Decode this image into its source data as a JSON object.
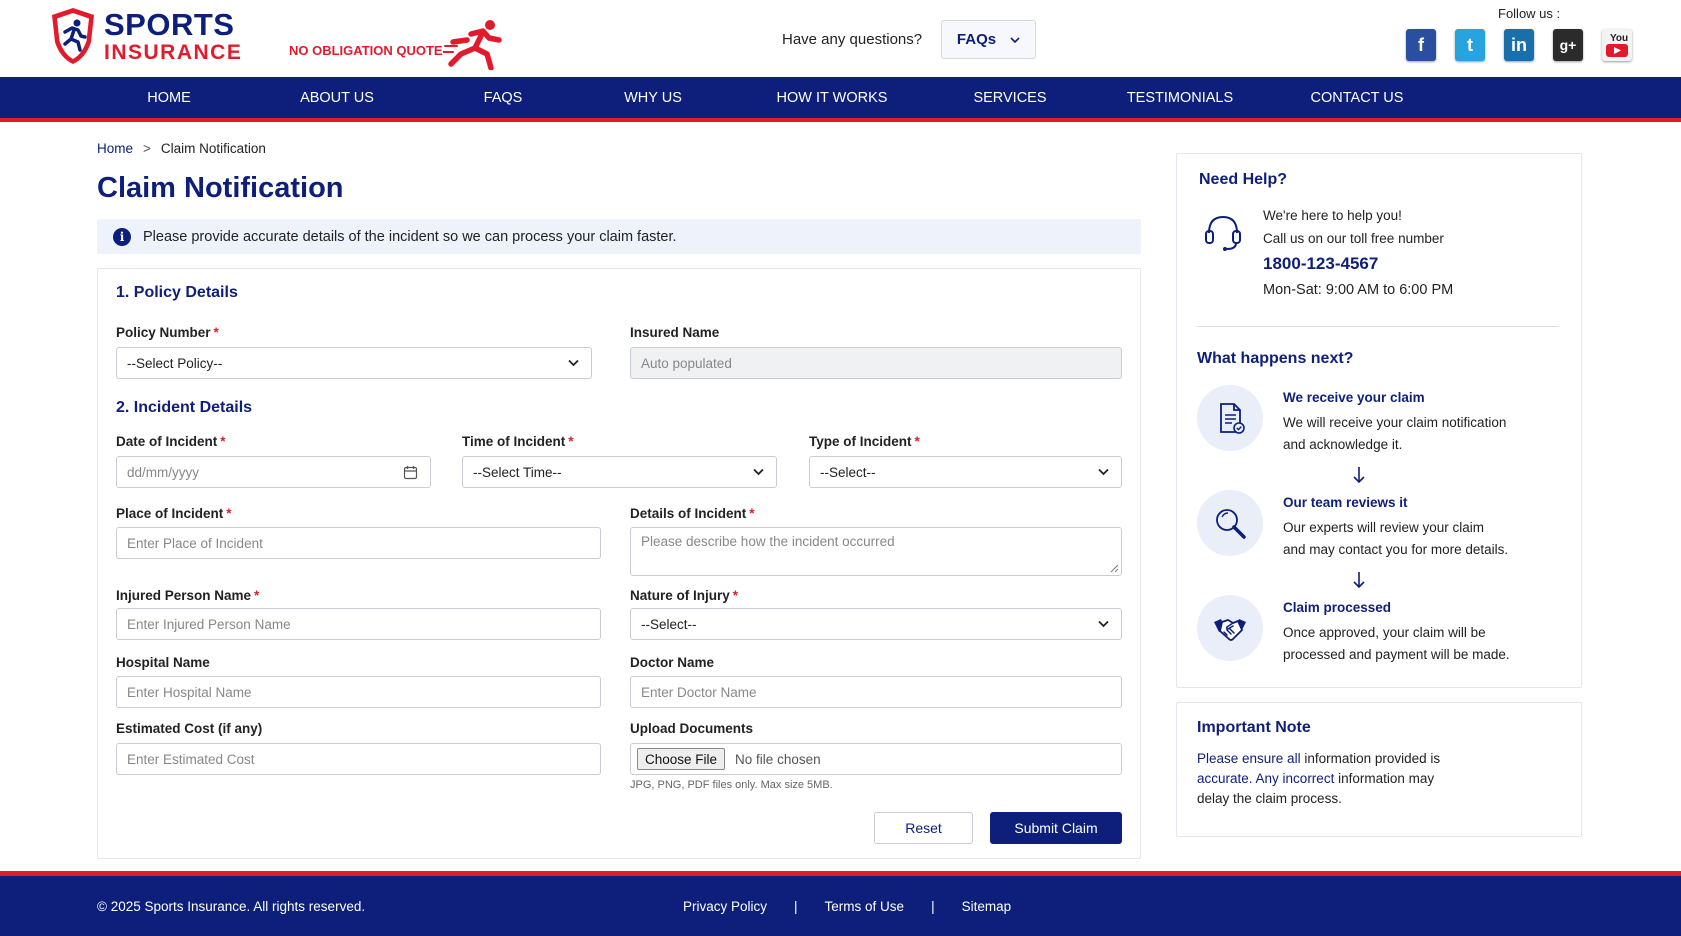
{
  "brand": {
    "name_line1": "SPORTS",
    "name_line2": "INSURANCE",
    "tagline": "NO OBLIGATION QUOTE",
    "primary_color": "#0d1f7a",
    "accent_color": "#e21b2c"
  },
  "header": {
    "questions_text": "Have any questions?",
    "faqs_label": "FAQs",
    "follow_label": "Follow us :",
    "socials": [
      "facebook-icon",
      "twitter-icon",
      "linkedin-icon",
      "google-plus-icon",
      "youtube-icon"
    ]
  },
  "nav": {
    "items": [
      "HOME",
      "ABOUT US",
      "FAQS",
      "WHY US",
      "HOW IT WORKS",
      "SERVICES",
      "TESTIMONIALS",
      "CONTACT US"
    ],
    "active": "HOME"
  },
  "breadcrumb": {
    "home": "Home",
    "separator": ">",
    "current": "Claim Notification"
  },
  "page": {
    "title": "Claim Notification",
    "info": "Please provide accurate details of the incident so we can process your claim faster."
  },
  "form": {
    "section1": "1. Policy Details",
    "section2": "2. Incident Details",
    "policy_number": {
      "label": "Policy Number",
      "value": "--Select Policy--"
    },
    "insured_name": {
      "label": "Insured Name",
      "placeholder": "Auto populated"
    },
    "date_of_incident": {
      "label": "Date of Incident",
      "placeholder": "dd/mm/yyyy"
    },
    "time_of_incident": {
      "label": "Time of Incident",
      "value": "--Select Time--"
    },
    "type_of_incident": {
      "label": "Type of Incident",
      "value": "--Select--"
    },
    "place_of_incident": {
      "label": "Place of Incident",
      "placeholder": "Enter Place of Incident"
    },
    "details_of_incident": {
      "label": "Details of Incident",
      "placeholder": "Please describe how the incident occurred"
    },
    "injured_person": {
      "label": "Injured Person Name",
      "placeholder": "Enter Injured Person Name"
    },
    "nature_of_injury": {
      "label": "Nature of Injury",
      "value": "--Select--"
    },
    "hospital_name": {
      "label": "Hospital Name",
      "placeholder": "Enter Hospital Name"
    },
    "doctor_name": {
      "label": "Doctor Name",
      "placeholder": "Enter Doctor Name"
    },
    "estimated_cost": {
      "label": "Estimated Cost (if any)",
      "placeholder": "Enter Estimated Cost"
    },
    "upload": {
      "label": "Upload Documents",
      "button": "Choose File",
      "status": "No file chosen",
      "hint": "JPG, PNG, PDF files only. Max size 5MB."
    },
    "required_mark": "*",
    "reset_label": "Reset",
    "submit_label": "Submit Claim"
  },
  "help": {
    "title": "Need Help?",
    "line1": "We're here to help you!",
    "line2": "Call us on our toll free number",
    "phone": "1800-123-4567",
    "hours": "Mon-Sat: 9:00 AM to 6:00 PM",
    "next_title": "What happens next?",
    "steps": [
      {
        "icon": "document-icon",
        "title": "We receive your claim",
        "line1": "We will receive your claim notification",
        "line2": "and acknowledge it."
      },
      {
        "icon": "magnifier-icon",
        "title": "Our team reviews it",
        "line1": "Our experts will review your claim",
        "line2": "and may contact you for more details."
      },
      {
        "icon": "handshake-icon",
        "title": "Claim processed",
        "line1": "Once approved, your claim will be",
        "line2": "processed and payment will be made."
      }
    ]
  },
  "note": {
    "title": "Important Note",
    "p1": "Please ensure all",
    "p2": " information provided is ",
    "p3": "accurate. Any incorrect",
    "p4": " information may delay the claim process."
  },
  "footer": {
    "copyright": "© 2025 Sports Insurance. All rights reserved.",
    "links": [
      "Privacy Policy",
      "Terms of Use",
      "Sitemap"
    ],
    "separator": "|"
  }
}
